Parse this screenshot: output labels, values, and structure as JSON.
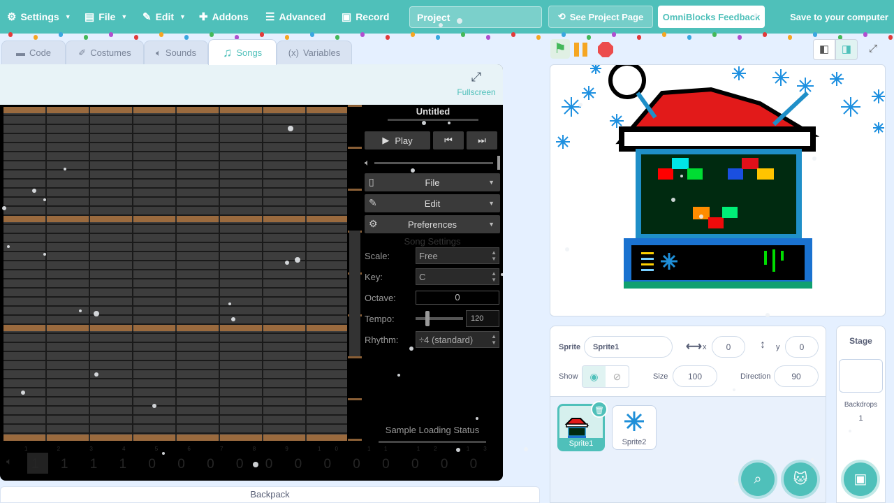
{
  "menubar": {
    "settings": "Settings",
    "file": "File",
    "edit": "Edit",
    "addons": "Addons",
    "advanced": "Advanced",
    "record": "Record",
    "project_title": "Project",
    "see_project_page": "See Project Page",
    "feedback": "OmniBlocks Feedback",
    "save": "Save to your computer"
  },
  "tabs": {
    "code": "Code",
    "costumes": "Costumes",
    "sounds": "Sounds",
    "songs": "Songs",
    "variables": "Variables"
  },
  "songs_editor": {
    "fullscreen": "Fullscreen",
    "song_title": "Untitled",
    "play": "Play",
    "file_menu": "File",
    "edit_menu": "Edit",
    "preferences_menu": "Preferences",
    "song_settings": "Song Settings",
    "scale_label": "Scale:",
    "scale_value": "Free",
    "key_label": "Key:",
    "key_value": "C",
    "octave_label": "Octave:",
    "octave_value": "0",
    "tempo_label": "Tempo:",
    "tempo_value": "120",
    "rhythm_label": "Rhythm:",
    "rhythm_value": "÷4 (standard)",
    "sample_loading_status": "Sample Loading Status",
    "seq_numbers": "1 2 3 4 5 6 7 8 9 10 11 12 13 14 15 16",
    "seq_values": "1 1 1 1 0 0 0 0 0 0 0 0 0 0 0 0"
  },
  "backpack": "Backpack",
  "sprite_info": {
    "sprite_label": "Sprite",
    "sprite_name": "Sprite1",
    "x_label": "x",
    "x_value": "0",
    "y_label": "y",
    "y_value": "0",
    "show_label": "Show",
    "size_label": "Size",
    "size_value": "100",
    "direction_label": "Direction",
    "direction_value": "90"
  },
  "sprites": [
    {
      "name": "Sprite1",
      "selected": true
    },
    {
      "name": "Sprite2",
      "selected": false
    }
  ],
  "stage_pane": {
    "title": "Stage",
    "backdrops_label": "Backdrops",
    "backdrops_count": "1"
  },
  "icons": {
    "settings": "gear-icon",
    "file": "file-icon",
    "edit": "pencil-icon",
    "addons": "puzzle-icon",
    "advanced": "sliders-icon",
    "record": "camera-icon",
    "green_flag": "green-flag-icon",
    "pause": "pause-icon",
    "stop": "stop-icon"
  },
  "colors": {
    "accent": "#4fc0ba",
    "menubar": "#4fc0ba",
    "editor_bg": "#000000",
    "note_row": "#3d3d3d",
    "bar_row": "#9a6a3e",
    "flag": "#45b85a",
    "pause": "#f5a623",
    "stop": "#ec4c4c"
  }
}
